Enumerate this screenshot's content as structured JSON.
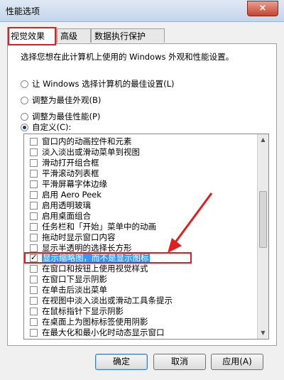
{
  "window": {
    "title": "性能选项",
    "close_icon": "×"
  },
  "tabs": [
    {
      "label": "视觉效果"
    },
    {
      "label": "高级"
    },
    {
      "label": "数据执行保护"
    }
  ],
  "visual_effects": {
    "description": "选择您想在此计算机上使用的 Windows 外观和性能设置。",
    "radios": [
      {
        "label": "让 Windows 选择计算机的最佳设置(L)",
        "selected": false
      },
      {
        "label": "调整为最佳外观(B)",
        "selected": false
      },
      {
        "label": "调整为最佳性能(P)",
        "selected": false
      },
      {
        "label": "自定义(C):",
        "selected": true
      }
    ],
    "options": [
      {
        "label": "窗口内的动画控件和元素",
        "checked": false
      },
      {
        "label": "淡入淡出或滑动菜单到视图",
        "checked": false
      },
      {
        "label": "滑动打开组合框",
        "checked": false
      },
      {
        "label": "平滑滚动列表框",
        "checked": false
      },
      {
        "label": "平滑屏幕字体边缘",
        "checked": false
      },
      {
        "label": "启用 Aero Peek",
        "checked": false
      },
      {
        "label": "启用透明玻璃",
        "checked": false
      },
      {
        "label": "启用桌面组合",
        "checked": false
      },
      {
        "label": "任务栏和「开始」菜单中的动画",
        "checked": false
      },
      {
        "label": "拖动时显示窗口内容",
        "checked": false
      },
      {
        "label": "显示半透明的选择长方形",
        "checked": false
      },
      {
        "label": "显示缩略图，而不是显示图标",
        "checked": true
      },
      {
        "label": "在窗口和按钮上使用视觉样式",
        "checked": false
      },
      {
        "label": "在窗口下显示阴影",
        "checked": false
      },
      {
        "label": "在单击后淡出菜单",
        "checked": false
      },
      {
        "label": "在视图中淡入淡出或滑动工具条提示",
        "checked": false
      },
      {
        "label": "在鼠标指针下显示阴影",
        "checked": false
      },
      {
        "label": "在桌面上为图标标签使用阴影",
        "checked": false
      },
      {
        "label": "在最大化和最小化时动态显示窗口",
        "checked": false
      }
    ]
  },
  "buttons": {
    "ok": "确定",
    "cancel": "取消",
    "apply": "应用(A)"
  },
  "colors": {
    "annotation_red": "#e02020",
    "selection_blue": "#3399ff"
  }
}
